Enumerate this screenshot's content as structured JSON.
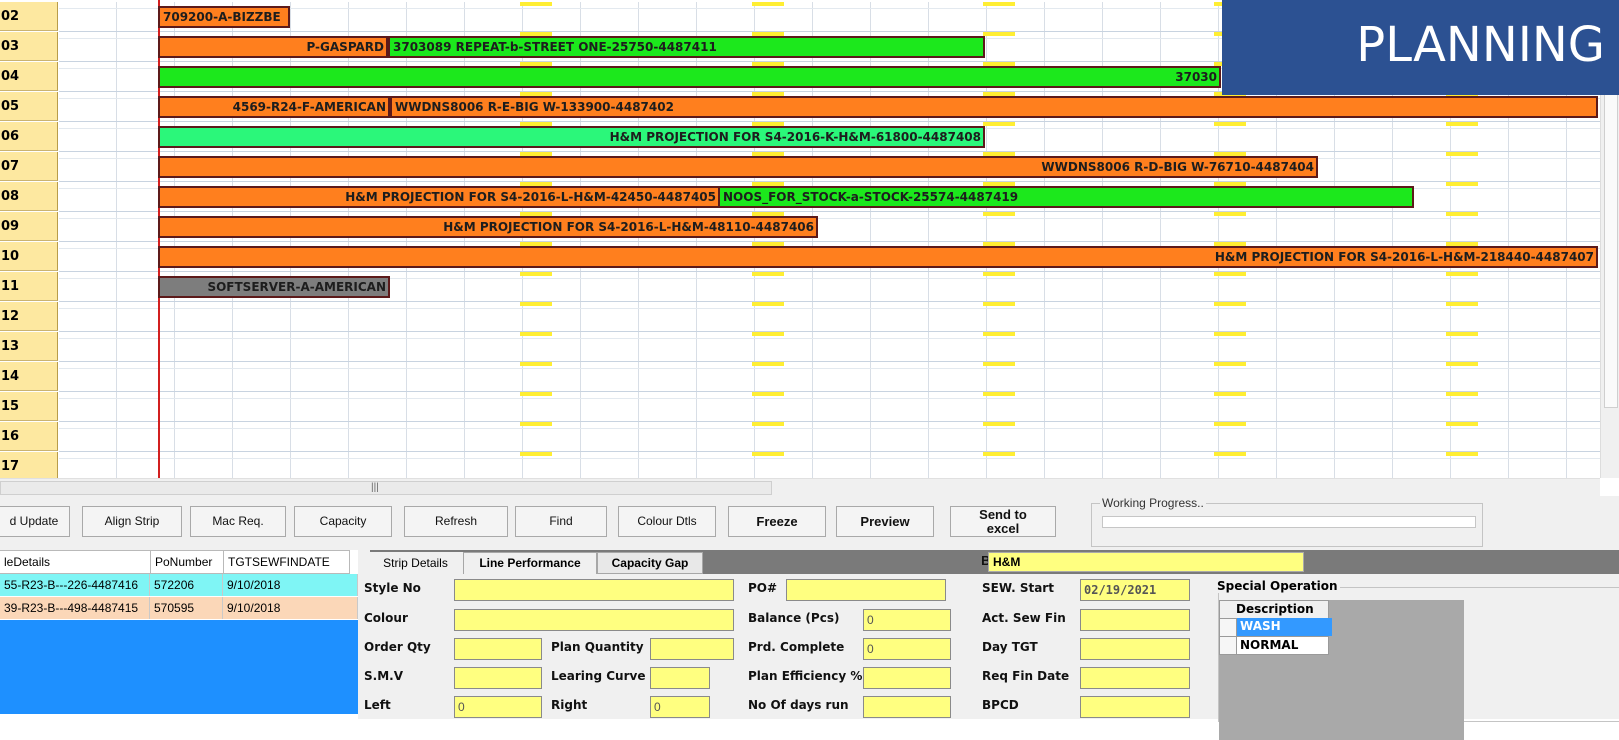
{
  "banner": {
    "title": "PLANNING"
  },
  "rows": [
    {
      "label": "02"
    },
    {
      "label": "03"
    },
    {
      "label": "04"
    },
    {
      "label": "05"
    },
    {
      "label": "06"
    },
    {
      "label": "07"
    },
    {
      "label": "08"
    },
    {
      "label": "09"
    },
    {
      "label": "10"
    },
    {
      "label": "11"
    },
    {
      "label": "12"
    },
    {
      "label": "13"
    },
    {
      "label": "14"
    },
    {
      "label": "15"
    },
    {
      "label": "16"
    },
    {
      "label": "17"
    }
  ],
  "strips": [
    {
      "row": 0,
      "text": "709200-A-BIZZBE",
      "color": "#ff7f1e"
    },
    {
      "row": 1,
      "text": "P-GASPARD",
      "color": "#ff7f1e"
    },
    {
      "row": 1,
      "text": "3703089 REPEAT-b-STREET ONE-25750-4487411",
      "color": "#1ce81c"
    },
    {
      "row": 2,
      "text": "37030",
      "color": "#1ce81c"
    },
    {
      "row": 3,
      "text": "4569-R24-F-AMERICAN",
      "color": "#ff7f1e"
    },
    {
      "row": 3,
      "text": "WWDNS8006 R-E-BIG W-133900-4487402",
      "color": "#ff7f1e"
    },
    {
      "row": 4,
      "text": "H&M PROJECTION FOR S4-2016-K-H&M-61800-4487408",
      "color": "#2bf77a"
    },
    {
      "row": 5,
      "text": "WWDNS8006 R-D-BIG W-76710-4487404",
      "color": "#ff7f1e"
    },
    {
      "row": 6,
      "text": "H&M PROJECTION FOR S4-2016-L-H&M-42450-4487405",
      "color": "#ff7f1e"
    },
    {
      "row": 6,
      "text": "NOOS_FOR_STOCK-a-STOCK-25574-4487419",
      "color": "#1ce81c"
    },
    {
      "row": 7,
      "text": "H&M PROJECTION FOR S4-2016-L-H&M-48110-4487406",
      "color": "#ff7f1e"
    },
    {
      "row": 8,
      "text": "H&M PROJECTION FOR S4-2016-L-H&M-218440-4487407",
      "color": "#ff7f1e"
    },
    {
      "row": 9,
      "text": "SOFTSERVER-A-AMERICAN",
      "color": "#7d7d7d"
    }
  ],
  "toolbar": {
    "update": "d Update",
    "align": "Align Strip",
    "mac": "Mac Req.",
    "capacity": "Capacity",
    "refresh": "Refresh",
    "find": "Find",
    "colour": "Colour Dtls",
    "freeze": "Freeze",
    "preview": "Preview",
    "send1": "Send to",
    "send2": "excel",
    "working_progress": "Working Progress.."
  },
  "list": {
    "headers": [
      "leDetails",
      "PoNumber",
      "TGTSEWFINDATE"
    ],
    "rows": [
      {
        "details": "55-R23-B---226-4487416",
        "po": "572206",
        "date": "9/10/2018",
        "color": "#7ff5f5"
      },
      {
        "details": "39-R23-B---498-4487415",
        "po": "570595",
        "date": "9/10/2018",
        "color": "#fbd7b8"
      }
    ]
  },
  "tabs": [
    "Strip Details",
    "Line Performance",
    "Capacity Gap"
  ],
  "buyer": {
    "label": "Buyer",
    "value": "H&M"
  },
  "fields": {
    "style_no": {
      "label": "Style No",
      "value": ""
    },
    "colour": {
      "label": "Colour",
      "value": ""
    },
    "order_qty": {
      "label": "Order Qty",
      "value": ""
    },
    "smv": {
      "label": "S.M.V",
      "value": ""
    },
    "left": {
      "label": "Left",
      "value": "0"
    },
    "plan_qty": {
      "label": "Plan Quantity",
      "value": ""
    },
    "learning": {
      "label": "Learing Curve",
      "value": ""
    },
    "right": {
      "label": "Right",
      "value": "0"
    },
    "po": {
      "label": "PO#",
      "value": ""
    },
    "balance": {
      "label": "Balance (Pcs)",
      "value": "0"
    },
    "prd_complete": {
      "label": "Prd. Complete",
      "value": "0"
    },
    "plan_eff": {
      "label": "Plan Efficiency %",
      "value": ""
    },
    "days_run": {
      "label": "No Of days run",
      "value": ""
    },
    "sew_start": {
      "label": "SEW. Start",
      "value": "02/19/2021"
    },
    "act_sew_fin": {
      "label": "Act. Sew Fin",
      "value": ""
    },
    "day_tgt": {
      "label": "Day TGT",
      "value": ""
    },
    "req_fin": {
      "label": "Req Fin Date",
      "value": ""
    },
    "bpcd": {
      "label": "BPCD",
      "value": ""
    }
  },
  "special_op": {
    "label": "Special Operation",
    "header": "Description",
    "items": [
      "WASH",
      "NORMAL"
    ]
  }
}
